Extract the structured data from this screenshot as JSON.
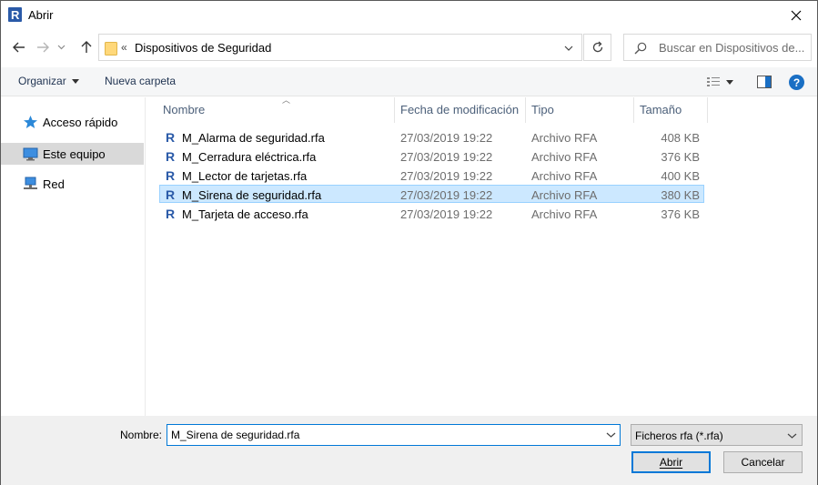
{
  "window": {
    "title": "Abrir"
  },
  "address": {
    "separator": "«",
    "path": "Dispositivos de Seguridad"
  },
  "search": {
    "placeholder": "Buscar en Dispositivos de..."
  },
  "toolbar": {
    "organize_label": "Organizar",
    "new_folder_label": "Nueva carpeta",
    "help_label": "?"
  },
  "sidebar": {
    "items": [
      {
        "label": "Acceso rápido",
        "icon": "star-icon"
      },
      {
        "label": "Este equipo",
        "icon": "computer-icon",
        "selected": true
      },
      {
        "label": "Red",
        "icon": "network-icon"
      }
    ]
  },
  "columns": {
    "name": "Nombre",
    "date": "Fecha de modificación",
    "type": "Tipo",
    "size": "Tamaño"
  },
  "files": [
    {
      "name": "M_Alarma de seguridad.rfa",
      "date": "27/03/2019 19:22",
      "type": "Archivo RFA",
      "size": "408 KB"
    },
    {
      "name": "M_Cerradura eléctrica.rfa",
      "date": "27/03/2019 19:22",
      "type": "Archivo RFA",
      "size": "376 KB"
    },
    {
      "name": "M_Lector de tarjetas.rfa",
      "date": "27/03/2019 19:22",
      "type": "Archivo RFA",
      "size": "400 KB"
    },
    {
      "name": "M_Sirena de seguridad.rfa",
      "date": "27/03/2019 19:22",
      "type": "Archivo RFA",
      "size": "380 KB",
      "selected": true
    },
    {
      "name": "M_Tarjeta de acceso.rfa",
      "date": "27/03/2019 19:22",
      "type": "Archivo RFA",
      "size": "376 KB"
    }
  ],
  "filename": {
    "label": "Nombre:",
    "value": "M_Sirena de seguridad.rfa"
  },
  "filter": {
    "selected": "Ficheros rfa (*.rfa)"
  },
  "buttons": {
    "open": "Abrir",
    "cancel": "Cancelar"
  },
  "colors": {
    "accent": "#0078d7",
    "selection": "#cce8ff",
    "revit_blue": "#2a5aa8"
  }
}
